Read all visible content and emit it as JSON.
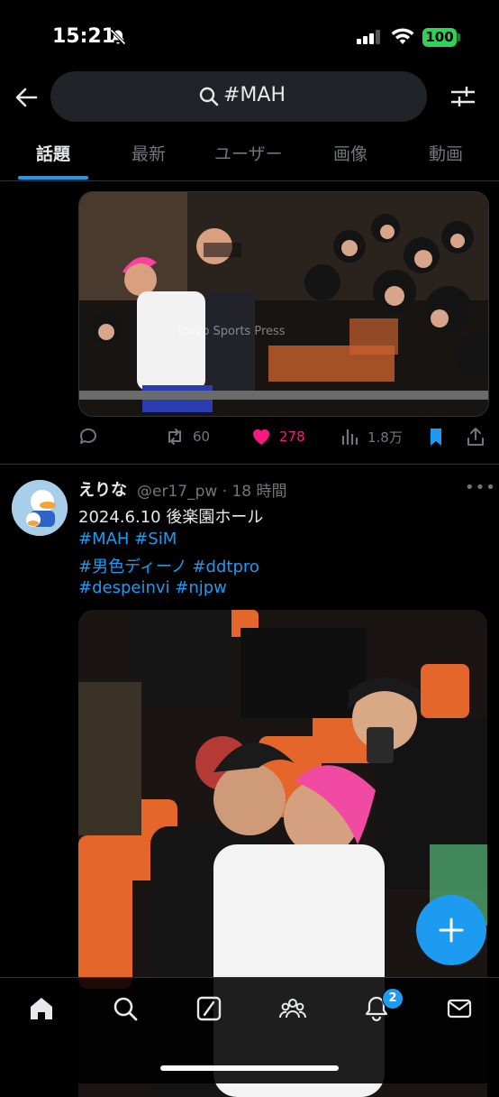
{
  "status": {
    "time": "15:21",
    "battery": "100"
  },
  "search": {
    "query": "#MAH"
  },
  "tabs": [
    {
      "label": "話題",
      "active": true
    },
    {
      "label": "最新"
    },
    {
      "label": "ユーザー"
    },
    {
      "label": "画像"
    },
    {
      "label": "動画"
    }
  ],
  "post1": {
    "image_watermark": "Tokyo Sports Press",
    "retweets": "60",
    "likes": "278",
    "views": "1.8万"
  },
  "post2": {
    "name": "えりな",
    "handle": "@er17_pw · 18 時間",
    "line1": "2024.6.10 後楽園ホール",
    "tags1": "#MAH #SiM",
    "tags2": "#男色ディーノ #ddtpro",
    "tags3": "#despeinvi #njpw"
  },
  "nav": {
    "notifications_badge": "2"
  },
  "colors": {
    "accent": "#1d9bf0",
    "like": "#f91880",
    "bg": "#000000"
  }
}
